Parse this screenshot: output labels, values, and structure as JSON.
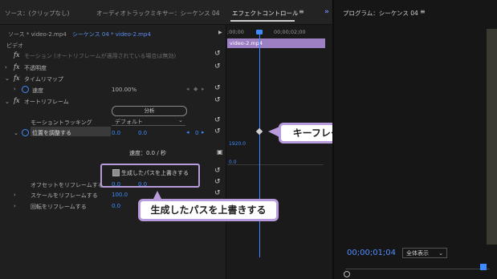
{
  "tabs": [
    {
      "label": "ソース：(クリップなし)"
    },
    {
      "label": "オーディオトラックミキサー：シーケンス 04"
    },
    {
      "label": "エフェクトコントロール"
    }
  ],
  "tab_menu_icon": "≡",
  "overflow_icon": "»",
  "program": {
    "title": "プログラム：シーケンス 04",
    "menu_icon": "≡",
    "timecode": "00;00;01;04",
    "fit": "全体表示",
    "fit_arrow": "⌄"
  },
  "clip_selector": {
    "source": "ソース * video-2.mp4",
    "sequence": "シーケンス 04 * video-2.mp4",
    "play_icon": "▶"
  },
  "timeline": {
    "ruler_start": ";00;00",
    "ruler_mid": "00;00;02;00",
    "clip_name": "video-2.mp4"
  },
  "section_video": "ビデオ",
  "effects": {
    "motion": {
      "fx": "fx",
      "label": "モーション (オートリフレームが適用されている場合は無効)",
      "reset": "↺"
    },
    "opacity": {
      "fx": "fx",
      "label": "不透明度",
      "reset": "↺"
    },
    "time_remap": {
      "fx": "fx",
      "label": "タイムリマップ"
    },
    "speed": {
      "label": "速度",
      "value": "100.00%",
      "kf_prev": "◂",
      "kf_add": "◆",
      "kf_next": "▸",
      "reset": "↺"
    },
    "auto_reframe": {
      "fx": "fx",
      "label": "オートリフレーム",
      "reset": "↺"
    },
    "analyze_button": "分析",
    "motion_tracking": {
      "label": "モーショントラッキング",
      "value": "デフォルト",
      "arrow": "⌄",
      "reset": "↺"
    },
    "adjust_position": {
      "label": "位置を調整する",
      "x": "0.0",
      "y": "0.0",
      "kf_value": "0",
      "reset": "↺"
    },
    "ruler_max": "1920.0",
    "speed_readout": "速度：0.0 / 秒",
    "ruler_min": "0.0",
    "override_path": {
      "label": "生成したパスを上書きする",
      "checked": true,
      "reset": "↺"
    },
    "offset_reframe": {
      "label": "オフセットをリフレームする",
      "x": "0.0",
      "y": "0.0",
      "reset": "↺"
    },
    "scale_reframe": {
      "label": "スケールをリフレームする",
      "value": "100.0",
      "reset": "↺"
    },
    "rotation_reframe": {
      "label": "回転をリフレームする",
      "value": "0.0",
      "reset": "↺"
    }
  },
  "callouts": {
    "keyframe": "キーフレームで調整できる",
    "override": "生成したパスを上書きする"
  },
  "colors": {
    "accent_blue": "#3d8bff",
    "callout_border": "#b79bdc",
    "clip_purple": "#9d7fc4"
  }
}
